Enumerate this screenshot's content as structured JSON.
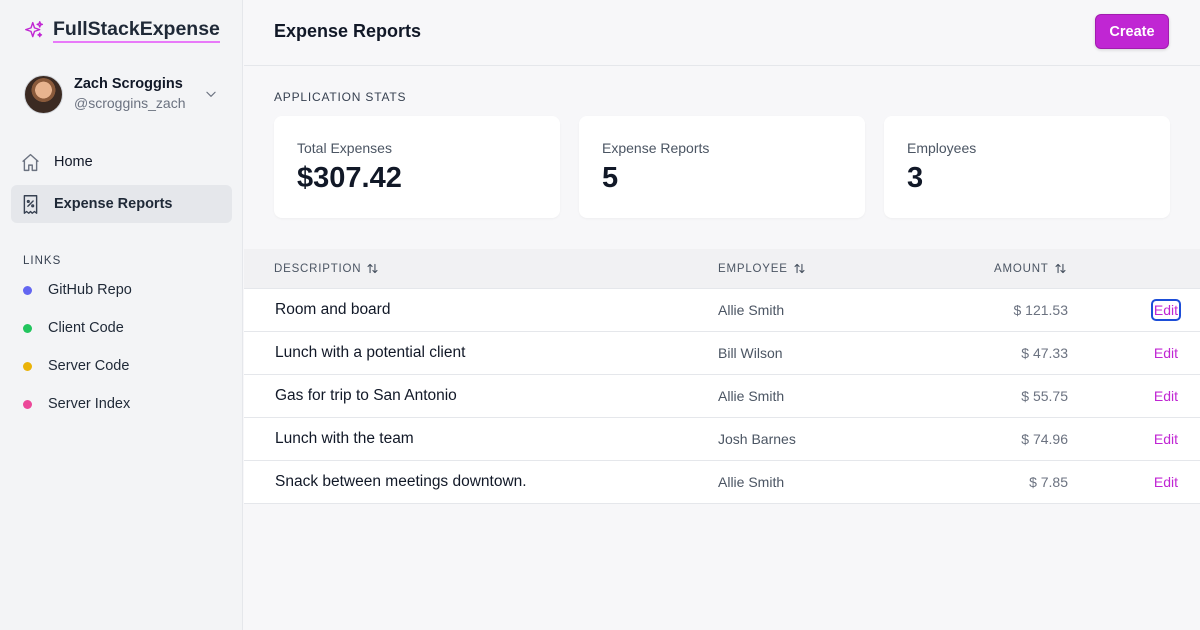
{
  "app": {
    "name": "FullStackExpense"
  },
  "user": {
    "name": "Zach Scroggins",
    "handle": "@scroggins_zach"
  },
  "nav": [
    {
      "label": "Home",
      "icon": "home-icon",
      "active": false
    },
    {
      "label": "Expense Reports",
      "icon": "receipt-icon",
      "active": true
    }
  ],
  "links": {
    "heading": "LINKS",
    "items": [
      {
        "label": "GitHub Repo",
        "color": "#6366f1"
      },
      {
        "label": "Client Code",
        "color": "#22c55e"
      },
      {
        "label": "Server Code",
        "color": "#eab308"
      },
      {
        "label": "Server Index",
        "color": "#ec4899"
      }
    ]
  },
  "header": {
    "title": "Expense Reports",
    "create_label": "Create"
  },
  "stats": {
    "heading": "APPLICATION STATS",
    "cards": [
      {
        "label": "Total Expenses",
        "value": "$307.42"
      },
      {
        "label": "Expense Reports",
        "value": "5"
      },
      {
        "label": "Employees",
        "value": "3"
      }
    ]
  },
  "table": {
    "columns": [
      "DESCRIPTION",
      "EMPLOYEE",
      "AMOUNT"
    ],
    "edit_label": "Edit",
    "rows": [
      {
        "description": "Room and board",
        "employee": "Allie Smith",
        "amount": "$ 121.53"
      },
      {
        "description": "Lunch with a potential client",
        "employee": "Bill Wilson",
        "amount": "$ 47.33"
      },
      {
        "description": "Gas for trip to San Antonio",
        "employee": "Allie Smith",
        "amount": "$ 55.75"
      },
      {
        "description": "Lunch with the team",
        "employee": "Josh Barnes",
        "amount": "$ 74.96"
      },
      {
        "description": "Snack between meetings downtown.",
        "employee": "Allie Smith",
        "amount": "$ 7.85"
      }
    ]
  },
  "colors": {
    "accent": "#c026d3",
    "brand_underline": "#e879f9"
  }
}
